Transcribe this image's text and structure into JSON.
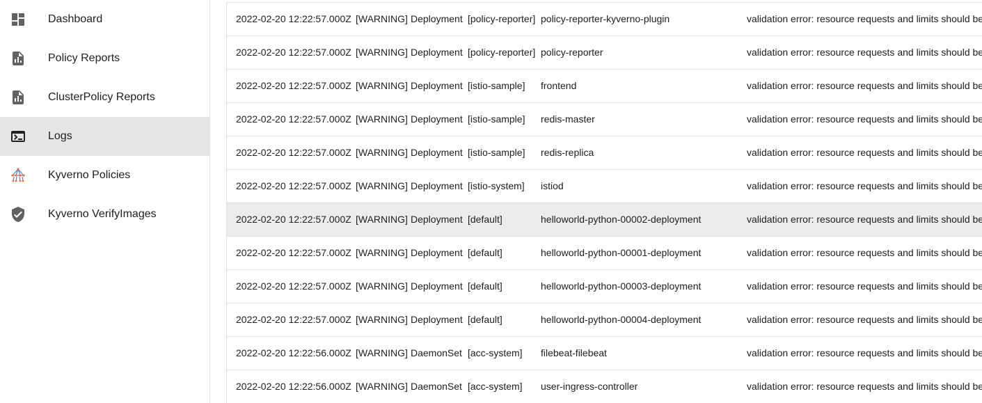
{
  "sidebar": {
    "items": [
      {
        "label": "Dashboard",
        "icon": "dashboard-icon"
      },
      {
        "label": "Policy Reports",
        "icon": "report-icon"
      },
      {
        "label": "ClusterPolicy Reports",
        "icon": "report-icon"
      },
      {
        "label": "Logs",
        "icon": "terminal-icon",
        "active": true
      },
      {
        "label": "Kyverno Policies",
        "icon": "kyverno-icon"
      },
      {
        "label": "Kyverno VerifyImages",
        "icon": "verified-shield-icon"
      }
    ]
  },
  "logs": {
    "rows": [
      {
        "timestamp": "2022-02-20 12:22:57.000Z",
        "level": "[WARNING]",
        "kind": "Deployment",
        "namespace": "[policy-reporter]",
        "name": "policy-reporter-kyverno-plugin",
        "message": "validation error: resource requests and limits should be"
      },
      {
        "timestamp": "2022-02-20 12:22:57.000Z",
        "level": "[WARNING]",
        "kind": "Deployment",
        "namespace": "[policy-reporter]",
        "name": "policy-reporter",
        "message": "validation error: resource requests and limits should be"
      },
      {
        "timestamp": "2022-02-20 12:22:57.000Z",
        "level": "[WARNING]",
        "kind": "Deployment",
        "namespace": "[istio-sample]",
        "name": "frontend",
        "message": "validation error: resource requests and limits should be"
      },
      {
        "timestamp": "2022-02-20 12:22:57.000Z",
        "level": "[WARNING]",
        "kind": "Deployment",
        "namespace": "[istio-sample]",
        "name": "redis-master",
        "message": "validation error: resource requests and limits should be"
      },
      {
        "timestamp": "2022-02-20 12:22:57.000Z",
        "level": "[WARNING]",
        "kind": "Deployment",
        "namespace": "[istio-sample]",
        "name": "redis-replica",
        "message": "validation error: resource requests and limits should be"
      },
      {
        "timestamp": "2022-02-20 12:22:57.000Z",
        "level": "[WARNING]",
        "kind": "Deployment",
        "namespace": "[istio-system]",
        "name": "istiod",
        "message": "validation error: resource requests and limits should be"
      },
      {
        "timestamp": "2022-02-20 12:22:57.000Z",
        "level": "[WARNING]",
        "kind": "Deployment",
        "namespace": "[default]",
        "name": "helloworld-python-00002-deployment",
        "message": "validation error: resource requests and limits should be"
      },
      {
        "timestamp": "2022-02-20 12:22:57.000Z",
        "level": "[WARNING]",
        "kind": "Deployment",
        "namespace": "[default]",
        "name": "helloworld-python-00001-deployment",
        "message": "validation error: resource requests and limits should be"
      },
      {
        "timestamp": "2022-02-20 12:22:57.000Z",
        "level": "[WARNING]",
        "kind": "Deployment",
        "namespace": "[default]",
        "name": "helloworld-python-00003-deployment",
        "message": "validation error: resource requests and limits should be"
      },
      {
        "timestamp": "2022-02-20 12:22:57.000Z",
        "level": "[WARNING]",
        "kind": "Deployment",
        "namespace": "[default]",
        "name": "helloworld-python-00004-deployment",
        "message": "validation error: resource requests and limits should be"
      },
      {
        "timestamp": "2022-02-20 12:22:56.000Z",
        "level": "[WARNING]",
        "kind": "DaemonSet",
        "namespace": "[acc-system]",
        "name": "filebeat-filebeat",
        "message": "validation error: resource requests and limits should be"
      },
      {
        "timestamp": "2022-02-20 12:22:56.000Z",
        "level": "[WARNING]",
        "kind": "DaemonSet",
        "namespace": "[acc-system]",
        "name": "user-ingress-controller",
        "message": "validation error: resource requests and limits should be"
      }
    ]
  },
  "colors": {
    "active_bg": "#e6e6e6",
    "hover_bg": "#ececec",
    "divider": "#e0e0e0",
    "icon": "#616161"
  }
}
